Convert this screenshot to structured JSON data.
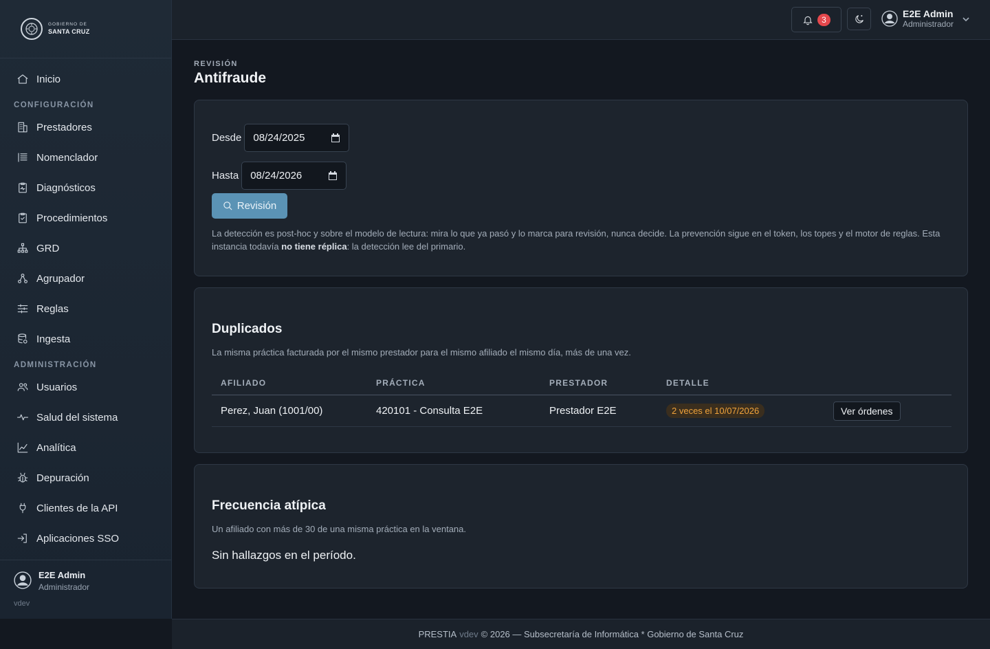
{
  "brand": {
    "top": "GOBIERNO DE",
    "bottom": "SANTA CRUZ"
  },
  "sidebar": {
    "items": [
      {
        "label": "Inicio",
        "icon": "home-icon"
      },
      {
        "section": "CONFIGURACIÓN"
      },
      {
        "label": "Prestadores",
        "icon": "building-icon"
      },
      {
        "label": "Nomenclador",
        "icon": "list-icon"
      },
      {
        "label": "Diagnósticos",
        "icon": "clipboard-pulse-icon"
      },
      {
        "label": "Procedimientos",
        "icon": "clipboard-check-icon"
      },
      {
        "label": "GRD",
        "icon": "hierarchy-icon"
      },
      {
        "label": "Agrupador",
        "icon": "group-icon"
      },
      {
        "label": "Reglas",
        "icon": "sliders-icon"
      },
      {
        "label": "Ingesta",
        "icon": "database-icon"
      },
      {
        "section": "ADMINISTRACIÓN"
      },
      {
        "label": "Usuarios",
        "icon": "users-icon"
      },
      {
        "label": "Salud del sistema",
        "icon": "pulse-icon"
      },
      {
        "label": "Analítica",
        "icon": "chart-icon"
      },
      {
        "label": "Depuración",
        "icon": "bug-icon"
      },
      {
        "label": "Clientes de la API",
        "icon": "plug-icon"
      },
      {
        "label": "Aplicaciones SSO",
        "icon": "login-icon"
      }
    ],
    "user_name": "E2E Admin",
    "user_role": "Administrador",
    "version": "vdev"
  },
  "topbar": {
    "notifications_count": "3",
    "user_name": "E2E Admin",
    "user_role": "Administrador"
  },
  "page": {
    "eyebrow": "REVISIÓN",
    "title": "Antifraude"
  },
  "filters": {
    "desde_label": "Desde",
    "desde_value": "08/24/2025",
    "hasta_label": "Hasta",
    "hasta_value": "08/24/2026",
    "button_label": "Revisión",
    "help_part1": "La detección es post-hoc y sobre el modelo de lectura: mira lo que ya pasó y lo marca para revisión, nunca decide. La prevención sigue en el token, los topes y el motor de reglas. Esta instancia todavía ",
    "help_bold": "no tiene réplica",
    "help_part2": ": la detección lee del primario."
  },
  "duplicados": {
    "title": "Duplicados",
    "subtitle": "La misma práctica facturada por el mismo prestador para el mismo afiliado el mismo día, más de una vez.",
    "columns": [
      "AFILIADO",
      "PRÁCTICA",
      "PRESTADOR",
      "DETALLE"
    ],
    "rows": [
      {
        "afiliado": "Perez, Juan (1001/00)",
        "practica": "420101 - Consulta E2E",
        "prestador": "Prestador E2E",
        "detalle": "2 veces el 10/07/2026",
        "action": "Ver órdenes"
      }
    ]
  },
  "frecuencia": {
    "title": "Frecuencia atípica",
    "subtitle": "Un afiliado con más de 30 de una misma práctica en la ventana.",
    "empty": "Sin hallazgos en el período."
  },
  "footer": {
    "app": "PRESTIA",
    "version": "vdev",
    "text": "© 2026 — Subsecretaría de Informática * Gobierno de Santa Cruz"
  }
}
